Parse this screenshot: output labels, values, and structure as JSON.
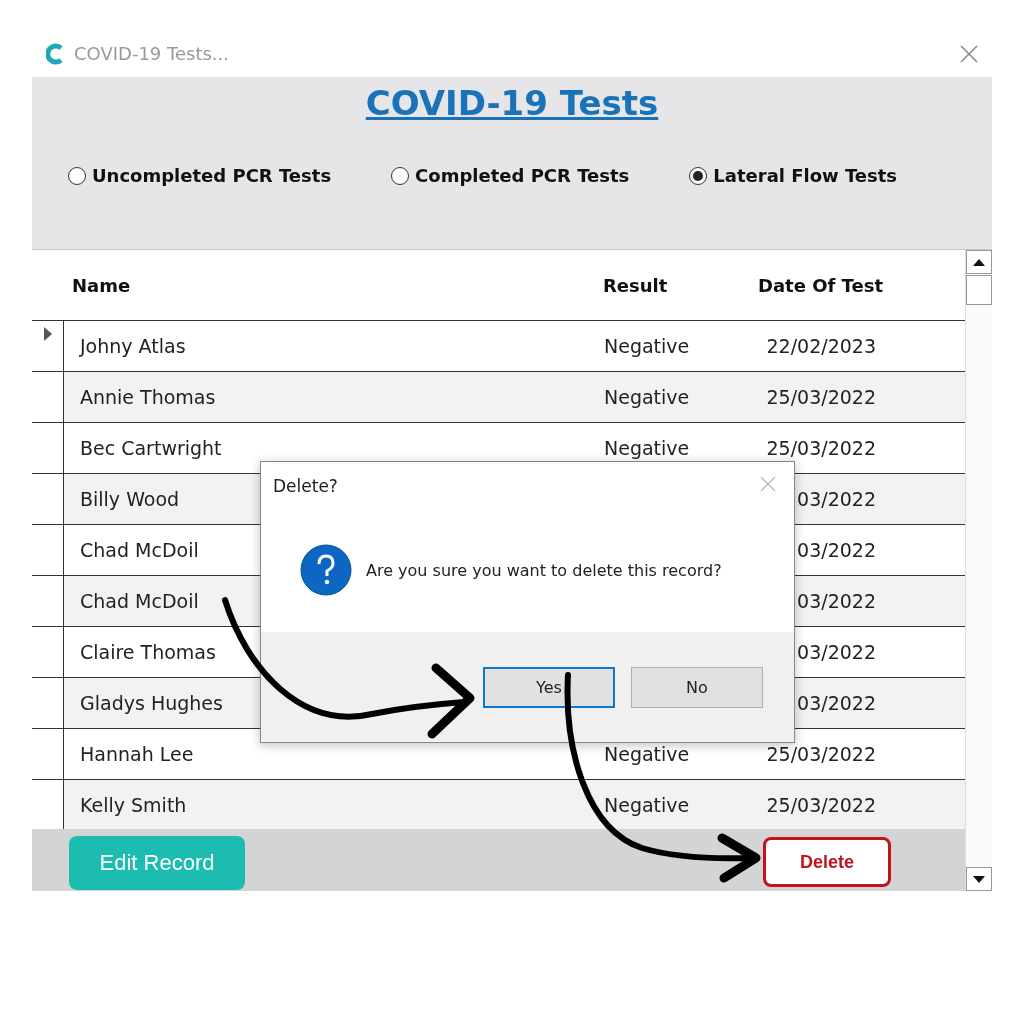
{
  "window": {
    "title": "COVID-19 Tests..."
  },
  "heading": "COVID-19 Tests",
  "filters": [
    {
      "label": "Uncompleted PCR Tests",
      "selected": false
    },
    {
      "label": "Completed PCR Tests",
      "selected": false
    },
    {
      "label": "Lateral Flow Tests",
      "selected": true
    }
  ],
  "table": {
    "columns": [
      "Name",
      "Result",
      "Date Of Test"
    ],
    "rows": [
      {
        "name": "Johny Atlas",
        "result": "Negative",
        "date": "22/02/2023",
        "selected": true
      },
      {
        "name": "Annie Thomas",
        "result": "Negative",
        "date": "25/03/2022",
        "selected": false
      },
      {
        "name": "Bec Cartwright",
        "result": "Negative",
        "date": "25/03/2022",
        "selected": false
      },
      {
        "name": "Billy Wood",
        "date": "03/2022",
        "selected": false
      },
      {
        "name": "Chad McDoil",
        "date": "03/2022",
        "selected": false
      },
      {
        "name": "Chad McDoil",
        "date": "03/2022",
        "selected": false
      },
      {
        "name": "Claire Thomas",
        "date": "03/2022",
        "selected": false
      },
      {
        "name": "Gladys Hughes",
        "date": "03/2022",
        "selected": false
      },
      {
        "name": "Hannah Lee",
        "result": "Negative",
        "date": "25/03/2022",
        "selected": false
      },
      {
        "name": "Kelly Smith",
        "result": "Negative",
        "date": "25/03/2022",
        "selected": false
      }
    ]
  },
  "actions": [
    {
      "label": "Edit Record",
      "kind": "primary"
    },
    {
      "label": "Delete",
      "kind": "danger"
    }
  ],
  "dialog": {
    "title": "Delete?",
    "message": "Are you sure you want to delete this record?",
    "buttons": [
      {
        "label": "Yes",
        "selected": true
      },
      {
        "label": "No",
        "selected": false
      }
    ]
  }
}
